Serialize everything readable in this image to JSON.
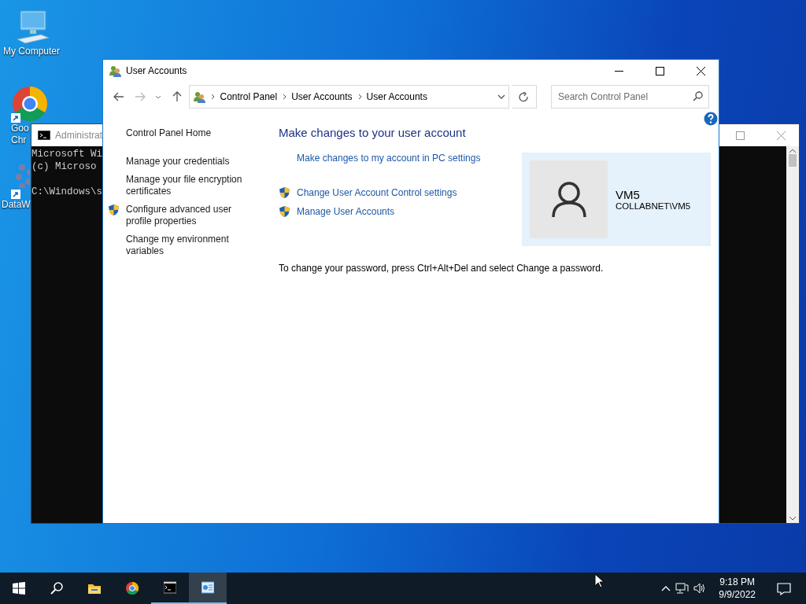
{
  "desktop": {
    "icons": [
      {
        "kind": "computer",
        "lines": [
          "My Computer"
        ],
        "shortcut": false
      },
      {
        "kind": "chrome",
        "lines": [
          "Goo",
          "Chr"
        ],
        "shortcut": true
      },
      {
        "kind": "grid",
        "lines": [
          "DataW"
        ],
        "shortcut": true
      }
    ]
  },
  "console_window": {
    "title": "Administrat",
    "blocks": [
      [
        "Microsoft Wi",
        "(c) Microso"
      ],
      [
        "C:\\Windows\\s"
      ]
    ]
  },
  "user_accounts_window": {
    "title": "User Accounts",
    "breadcrumb": [
      "Control Panel",
      "User Accounts",
      "User Accounts"
    ],
    "search": {
      "placeholder": "Search Control Panel"
    },
    "sidebar": {
      "items": [
        {
          "label": "Control Panel Home",
          "shield": false
        },
        {
          "label": "Manage your credentials",
          "shield": false
        },
        {
          "label": "Manage your file encryption certificates",
          "shield": false
        },
        {
          "label": "Configure advanced user profile properties",
          "shield": true
        },
        {
          "label": "Change my environment variables",
          "shield": false
        }
      ]
    },
    "heading": "Make changes to your user account",
    "links": [
      {
        "label": "Make changes to my account in PC settings",
        "shield": false
      },
      {
        "label": "Change User Account Control settings",
        "shield": true
      },
      {
        "label": "Manage User Accounts",
        "shield": true
      }
    ],
    "account": {
      "name": "VM5",
      "domain": "COLLABNET\\VM5"
    },
    "note": "To change your password, press Ctrl+Alt+Del and select Change a password."
  },
  "taskbar": {
    "items": [
      {
        "kind": "start",
        "running": false,
        "selected": false
      },
      {
        "kind": "search",
        "running": false,
        "selected": false
      },
      {
        "kind": "explorer",
        "running": false,
        "selected": false
      },
      {
        "kind": "chrome",
        "running": false,
        "selected": false
      },
      {
        "kind": "console",
        "running": true,
        "selected": false
      },
      {
        "kind": "control-panel",
        "running": true,
        "selected": true
      }
    ],
    "clock": {
      "time": "9:18 PM",
      "date": "9/9/2022"
    }
  }
}
